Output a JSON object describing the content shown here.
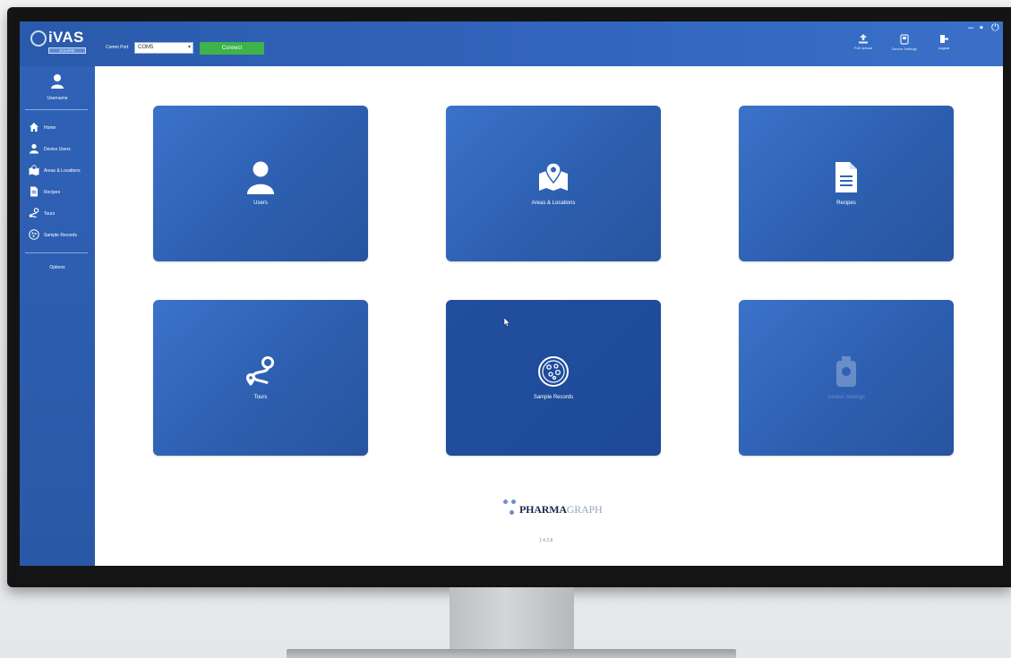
{
  "header": {
    "logo_text": "iVAS",
    "logo_sub": "ECLIPSE",
    "comm_port_label": "Comm Port",
    "comm_port_value": "COM5",
    "connect_label": "Connect",
    "actions": [
      {
        "icon": "upload-icon",
        "label": "Full Upload"
      },
      {
        "icon": "device-icon",
        "label": "Device Settings"
      },
      {
        "icon": "logout-icon",
        "label": "Logout"
      }
    ]
  },
  "sidebar": {
    "user_name": "Username",
    "items": [
      {
        "icon": "home-icon",
        "label": "Home"
      },
      {
        "icon": "user-icon",
        "label": "Device Users"
      },
      {
        "icon": "map-icon",
        "label": "Areas & Locations"
      },
      {
        "icon": "document-icon",
        "label": "Recipes"
      },
      {
        "icon": "route-icon",
        "label": "Tours"
      },
      {
        "icon": "petri-dish-icon",
        "label": "Sample Records"
      }
    ],
    "options_label": "Options"
  },
  "tiles": [
    {
      "icon": "user-icon",
      "label": "Users",
      "state": "normal"
    },
    {
      "icon": "map-icon",
      "label": "Areas & Locations",
      "state": "normal"
    },
    {
      "icon": "document-icon",
      "label": "Recipes",
      "state": "normal"
    },
    {
      "icon": "route-icon",
      "label": "Tours",
      "state": "normal"
    },
    {
      "icon": "petri-dish-icon",
      "label": "Sample Records",
      "state": "active"
    },
    {
      "icon": "device-icon",
      "label": "Device Settings",
      "state": "disabled"
    }
  ],
  "footer": {
    "brand_bold": "PHARMA",
    "brand_light": "GRAPH",
    "version": "1.4.2.8"
  },
  "colors": {
    "primary": "#2f62b7",
    "tile": "#3066b9",
    "tile_active": "#1f4c9c",
    "connect": "#3db34a"
  }
}
